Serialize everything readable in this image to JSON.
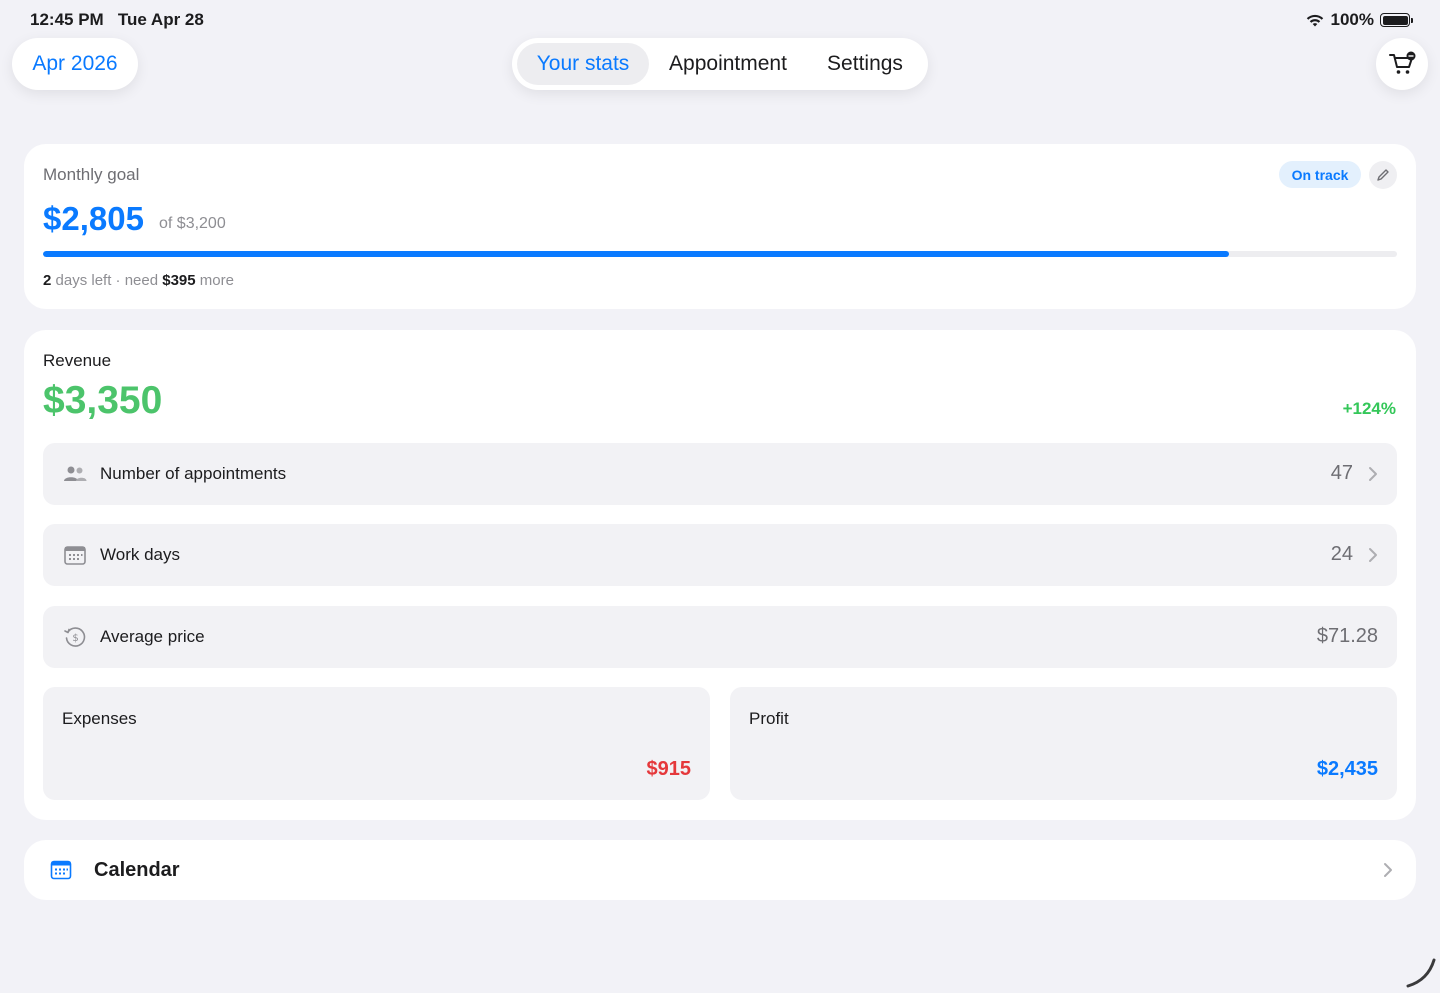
{
  "status_bar": {
    "time": "12:45 PM",
    "date": "Tue Apr 28",
    "battery": "100%"
  },
  "header": {
    "month": "Apr 2026",
    "tabs": [
      {
        "label": "Your stats",
        "active": true
      },
      {
        "label": "Appointment",
        "active": false
      },
      {
        "label": "Settings",
        "active": false
      }
    ]
  },
  "goal": {
    "label": "Monthly goal",
    "amount": "$2,805",
    "of_text": "of $3,200",
    "badge": "On track",
    "progress_fraction": 0.876,
    "days_left_num": "2",
    "days_left_text": "days left · need",
    "need_amount": "$395",
    "more_text": "more"
  },
  "revenue": {
    "label": "Revenue",
    "amount": "$3,350",
    "change": "+124%",
    "rows": [
      {
        "label": "Number of appointments",
        "value": "47",
        "icon": "people-icon"
      },
      {
        "label": "Work days",
        "value": "24",
        "icon": "calendar-grid-icon"
      },
      {
        "label": "Average price",
        "value": "$71.28",
        "icon": "dollar-history-icon"
      }
    ],
    "expenses": {
      "label": "Expenses",
      "amount": "$915"
    },
    "profit": {
      "label": "Profit",
      "amount": "$2,435"
    }
  },
  "calendar": {
    "label": "Calendar"
  },
  "colors": {
    "accent": "#0a7aff",
    "revenue_green": "#4cc46b",
    "expense_red": "#e5383b",
    "profit_blue": "#0a7aff",
    "background": "#f2f2f7"
  }
}
